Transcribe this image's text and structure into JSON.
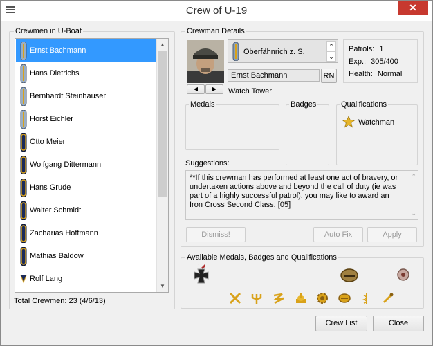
{
  "window": {
    "title": "Crew of U-19",
    "close_symbol": "✕"
  },
  "crewmen_group": {
    "label": "Crewmen in U-Boat",
    "items": [
      {
        "name": "Ernst Bachmann",
        "rank": "cadet"
      },
      {
        "name": "Hans Dietrichs",
        "rank": "cadet"
      },
      {
        "name": "Bernhardt Steinhauser",
        "rank": "cadet"
      },
      {
        "name": "Horst Eichler",
        "rank": "cadet"
      },
      {
        "name": "Otto Meier",
        "rank": "petty"
      },
      {
        "name": "Wolfgang Dittermann",
        "rank": "petty"
      },
      {
        "name": "Hans Grude",
        "rank": "petty"
      },
      {
        "name": "Walter Schmidt",
        "rank": "petty"
      },
      {
        "name": "Zacharias Hoffmann",
        "rank": "petty"
      },
      {
        "name": "Mathias Baldow",
        "rank": "petty"
      },
      {
        "name": "Rolf Lang",
        "rank": "chevron"
      }
    ],
    "total_text": "Total Crewmen: 23 (4/6/13)"
  },
  "details": {
    "label": "Crewman Details",
    "rank_value": "Oberfähnrich z. S.",
    "name_value": "Ernst Bachmann",
    "rn_label": "RN",
    "station": "Watch Tower",
    "patrols_label": "Patrols:",
    "patrols_value": "1",
    "exp_label": "Exp.:",
    "exp_value": "305/400",
    "health_label": "Health:",
    "health_value": "Normal",
    "medals_label": "Medals",
    "badges_label": "Badges",
    "quals_label": "Qualifications",
    "qual_item": "Watchman",
    "suggestions_label": "Suggestions:",
    "suggestion_text": "**If this crewman has performed at least one act of bravery, or undertaken actions above and beyond the call of duty (ie was part of a highly successful patrol), you may like to award an Iron Cross Second Class. [05]",
    "dismiss_label": "Dismiss!",
    "autofix_label": "Auto Fix",
    "apply_label": "Apply"
  },
  "available": {
    "label": "Available Medals, Badges and Qualifications"
  },
  "footer": {
    "crew_list_label": "Crew List",
    "close_label": "Close"
  },
  "colors": {
    "selection": "#3399ff",
    "close_red": "#c7392f",
    "gold": "#d9a21a",
    "navy": "#1a2a5a"
  }
}
